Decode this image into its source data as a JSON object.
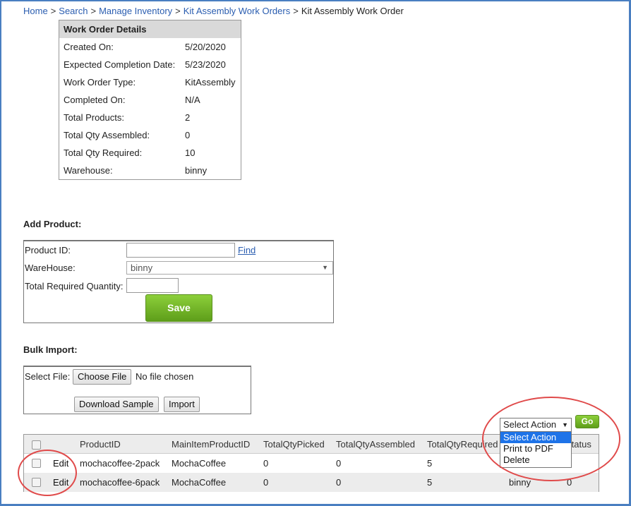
{
  "breadcrumb": {
    "items": [
      "Home",
      "Search",
      "Manage Inventory",
      "Kit Assembly Work Orders"
    ],
    "separator": ">",
    "current": "Kit Assembly Work Order"
  },
  "work_order": {
    "title": "Work Order Details",
    "rows": [
      {
        "label": "Created On:",
        "value": "5/20/2020"
      },
      {
        "label": "Expected Completion Date:",
        "value": "5/23/2020"
      },
      {
        "label": "Work Order Type:",
        "value": "KitAssembly"
      },
      {
        "label": "Completed On:",
        "value": "N/A"
      },
      {
        "label": "Total Products:",
        "value": "2"
      },
      {
        "label": "Total Qty Assembled:",
        "value": "0"
      },
      {
        "label": "Total Qty Required:",
        "value": "10"
      },
      {
        "label": "Warehouse:",
        "value": "binny"
      }
    ]
  },
  "add_product": {
    "title": "Add Product:",
    "product_id_label": "Product ID:",
    "product_id_value": "",
    "find_label": "Find",
    "warehouse_label": "WareHouse:",
    "warehouse_value": "binny",
    "qty_label": "Total Required Quantity:",
    "qty_value": "",
    "save_label": "Save"
  },
  "bulk_import": {
    "title": "Bulk Import:",
    "select_file_label": "Select File:",
    "choose_file_label": "Choose File",
    "no_file_label": "No file chosen",
    "download_sample_label": "Download Sample",
    "import_label": "Import"
  },
  "actions": {
    "selected": "Select Action",
    "options": [
      "Select Action",
      "Print to PDF",
      "Delete"
    ],
    "go_label": "Go"
  },
  "table": {
    "headers": [
      "ProductID",
      "MainItemProductID",
      "TotalQtyPicked",
      "TotalQtyAssembled",
      "TotalQtyRequired",
      "Status"
    ],
    "rows": [
      {
        "edit": "Edit",
        "product_id": "mochacoffee-2pack",
        "main_item": "MochaCoffee",
        "picked": "0",
        "assembled": "0",
        "required": "5",
        "warehouse": "",
        "status": ""
      },
      {
        "edit": "Edit",
        "product_id": "mochacoffee-6pack",
        "main_item": "MochaCoffee",
        "picked": "0",
        "assembled": "0",
        "required": "5",
        "warehouse": "binny",
        "status": "0"
      }
    ]
  },
  "colors": {
    "link": "#2a5db0",
    "accent_green": "#6cb225",
    "highlight_circle": "#e04a4a",
    "dropdown_selected": "#1e73e8"
  }
}
